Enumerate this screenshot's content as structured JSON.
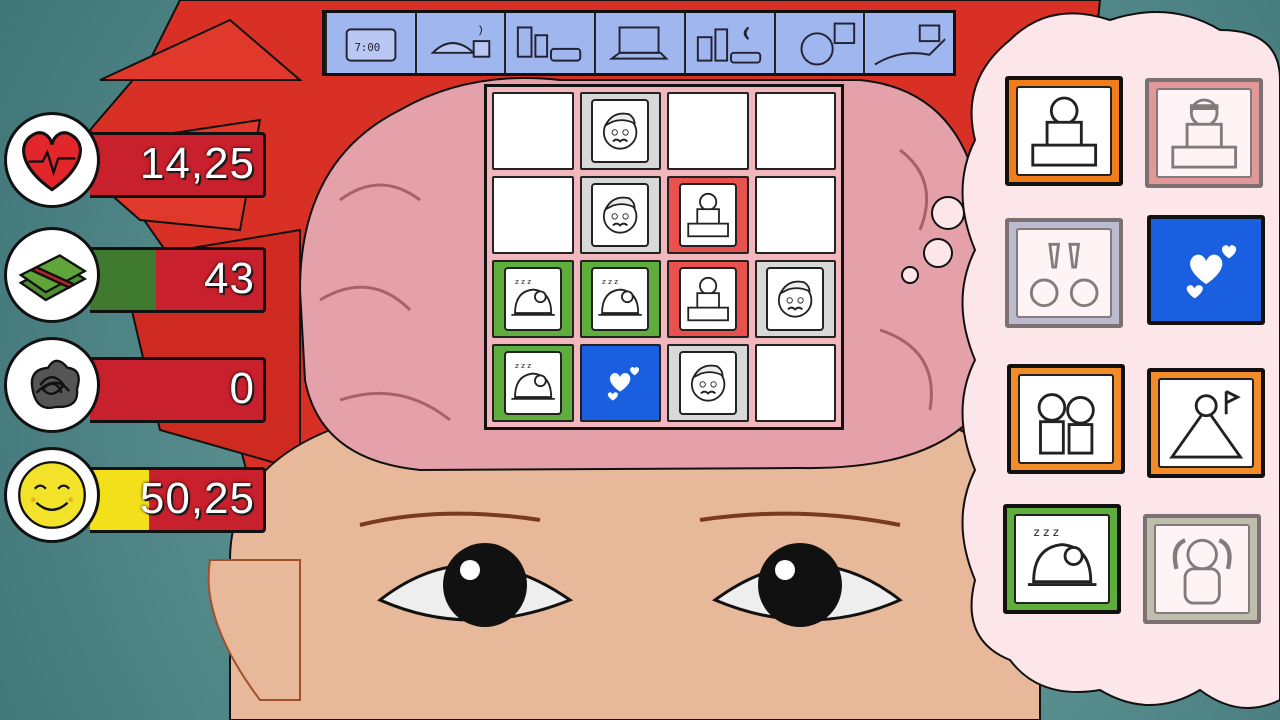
{
  "stats": [
    {
      "id": "health",
      "icon": "heart-icon",
      "value": "14,25",
      "fill": 0,
      "fill_color": "#3a7a33"
    },
    {
      "id": "money",
      "icon": "money-stack-icon",
      "value": "43",
      "fill": 0.38,
      "fill_color": "#3f7a30"
    },
    {
      "id": "stress",
      "icon": "scribble-cloud-icon",
      "value": "0",
      "fill": 0,
      "fill_color": "#3a7a33"
    },
    {
      "id": "happiness",
      "icon": "smiley-face-icon",
      "value": "50,25",
      "fill": 0.34,
      "fill_color": "#f3e01b"
    }
  ],
  "timeline": {
    "progress": 0.05,
    "segments": [
      "alarm-clock-icon",
      "breakfast-icon",
      "commute-city-icon",
      "laptop-work-icon",
      "evening-city-icon",
      "dinner-plate-icon",
      "road-trip-icon"
    ],
    "progress_color": "#d33131"
  },
  "grid": {
    "rows": 4,
    "cols": 4,
    "cells": [
      "empty",
      "worry",
      "empty",
      "empty",
      "empty",
      "worry",
      "work",
      "empty",
      "sleep",
      "sleep",
      "work",
      "worry",
      "sleep",
      "love",
      "worry",
      "empty"
    ]
  },
  "bubble_cards": [
    {
      "kind": "work",
      "color": "#f07d1a",
      "active": true
    },
    {
      "kind": "work-sad",
      "color": "#c95a58",
      "active": false
    },
    {
      "kind": "party",
      "color": "#8797b8",
      "active": false
    },
    {
      "kind": "love",
      "color": "#1a5fe0",
      "active": true
    },
    {
      "kind": "family",
      "color": "#f28b2a",
      "active": true
    },
    {
      "kind": "adventure",
      "color": "#f28b2a",
      "active": true
    },
    {
      "kind": "sleep",
      "color": "#5fae3d",
      "active": true
    },
    {
      "kind": "strength",
      "color": "#8a9e7c",
      "active": false
    }
  ],
  "colors": {
    "background": "#5f9494",
    "hair": "#d93025",
    "brain": "#e5a1a9",
    "skin": "#e8b89a"
  }
}
